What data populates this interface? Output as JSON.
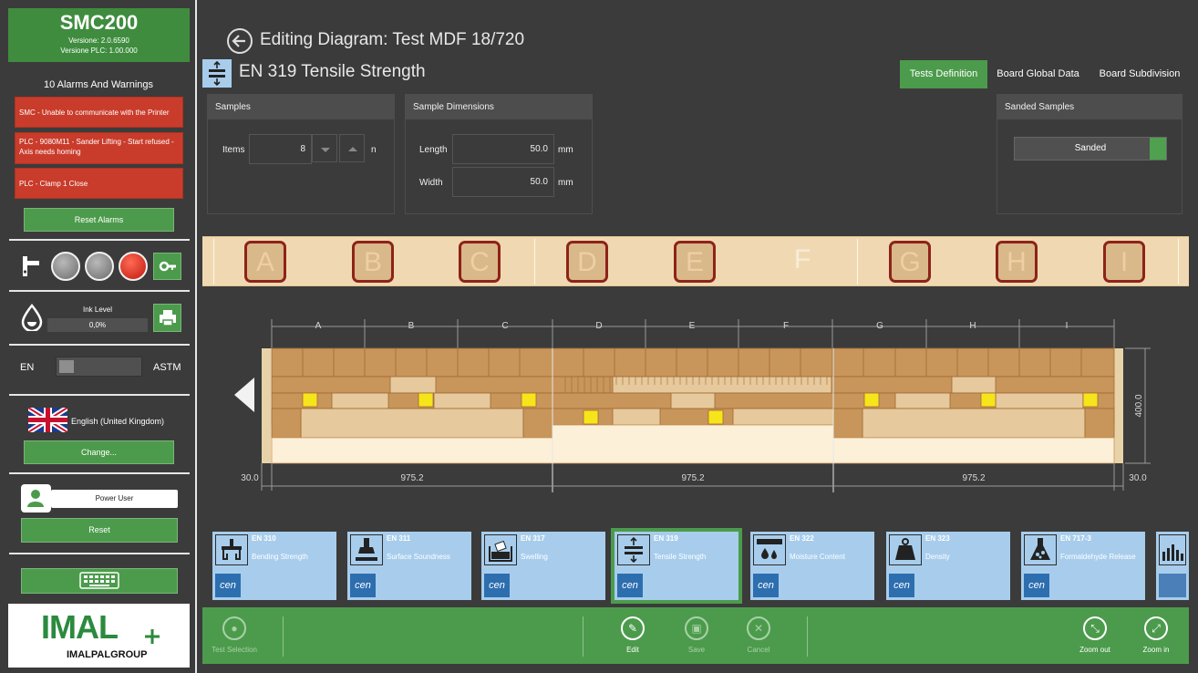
{
  "app": {
    "name": "SMC200",
    "version": "Versione: 2.0.6590",
    "plc_version": "Versione PLC: 1.00.000"
  },
  "alarms": {
    "title": "10 Alarms And Warnings",
    "items": [
      {
        "text": "SMC - Unable to communicate with the Printer"
      },
      {
        "text": "PLC - 9080M11 - Sander Lifting - Start refused - Axis needs homing"
      },
      {
        "text": "PLC - Clamp 1 Close"
      }
    ],
    "reset_label": "Reset Alarms"
  },
  "ink": {
    "label": "Ink Level",
    "value": "0,0%"
  },
  "units_toggle": {
    "left": "EN",
    "right": "ASTM"
  },
  "language": {
    "name": "English (United Kingdom)",
    "change_label": "Change..."
  },
  "user": {
    "role": "Power User",
    "reset_label": "Reset"
  },
  "brand": {
    "logo_text": "IMAL",
    "group_text": "IMALPALGROUP"
  },
  "header": {
    "title": "Editing Diagram: Test MDF 18/720",
    "test_name": "EN 319 Tensile Strength"
  },
  "tabs": [
    {
      "label": "Tests Definition",
      "active": true
    },
    {
      "label": "Board Global Data",
      "active": false
    },
    {
      "label": "Board Subdivision",
      "active": false
    }
  ],
  "samples": {
    "title": "Samples",
    "items_label": "Items",
    "items_value": "8",
    "unit": "n"
  },
  "dimensions": {
    "title": "Sample Dimensions",
    "length_label": "Length",
    "length_value": "50.0",
    "length_unit": "mm",
    "width_label": "Width",
    "width_value": "50.0",
    "width_unit": "mm"
  },
  "sanded": {
    "title": "Sanded Samples",
    "value": "Sanded"
  },
  "sections": [
    "A",
    "B",
    "C",
    "D",
    "E",
    "F",
    "G",
    "H",
    "I"
  ],
  "diagram": {
    "columns": [
      "A",
      "B",
      "C",
      "D",
      "E",
      "F",
      "G",
      "H",
      "I"
    ],
    "left_margin": "30.0",
    "right_margin": "30.0",
    "segment_width": "975.2",
    "height_label": "400.0"
  },
  "tests": [
    {
      "code": "EN 310",
      "name": "Bending Strength",
      "selected": false
    },
    {
      "code": "EN 311",
      "name": "Surface Soundness",
      "selected": false
    },
    {
      "code": "EN 317",
      "name": "Swelling",
      "selected": false
    },
    {
      "code": "EN 319",
      "name": "Tensile Strength",
      "selected": true
    },
    {
      "code": "EN 322",
      "name": "Moisture Content",
      "selected": false
    },
    {
      "code": "EN 323",
      "name": "Density",
      "selected": false
    },
    {
      "code": "EN 717-3",
      "name": "Formaldehyde Release",
      "selected": false
    }
  ],
  "cen_label": "cen",
  "toolbar": {
    "test_selection": "Test Selection",
    "edit": "Edit",
    "save": "Save",
    "cancel": "Cancel",
    "zoom_out": "Zoom out",
    "zoom_in": "Zoom in"
  },
  "colors": {
    "accent_green": "#4c9b4c",
    "alarm_red": "#c93c2b",
    "card_blue": "#a8cdec",
    "wood_light": "#f0d9b2",
    "wood_mid": "#d9b88a",
    "wood_dark": "#c8955a",
    "sample_yellow": "#f6e51a",
    "section_border": "#8e2318"
  }
}
